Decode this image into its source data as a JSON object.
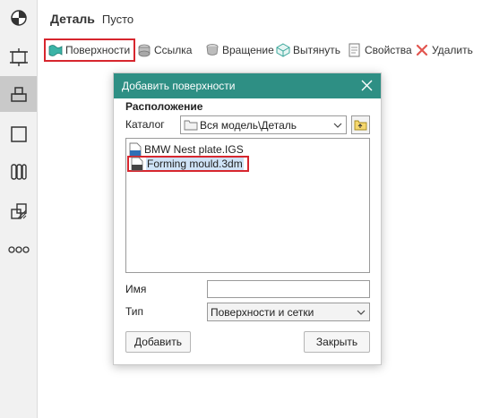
{
  "header": {
    "title": "Деталь",
    "subtitle": "Пусто"
  },
  "toolbar": {
    "surfaces": "Поверхности",
    "link": "Ссылка",
    "revolve": "Вращение",
    "extrude": "Вытянуть",
    "properties": "Свойства",
    "delete": "Удалить"
  },
  "leftbar": {
    "icons": [
      "part-icon",
      "assembly-icon",
      "part-view-icon",
      "sketch-icon",
      "layers-icon",
      "section-icon",
      "more-icon"
    ]
  },
  "dialog": {
    "title": "Добавить поверхности",
    "section_label": "Расположение",
    "catalog_label": "Каталог",
    "catalog_value": "Вся модель\\Деталь",
    "files": [
      {
        "name": "BMW Nest plate.IGS",
        "badge": "IGS"
      },
      {
        "name": "Forming mould.3dm",
        "badge": "3DM"
      }
    ],
    "name_label": "Имя",
    "name_value": "",
    "type_label": "Тип",
    "type_value": "Поверхности и сетки",
    "add_button": "Добавить",
    "close_button": "Закрыть"
  },
  "colors": {
    "dialog_title_bg": "#2e8f84",
    "highlight": "#d7262e",
    "selection": "#cfe3f7"
  }
}
